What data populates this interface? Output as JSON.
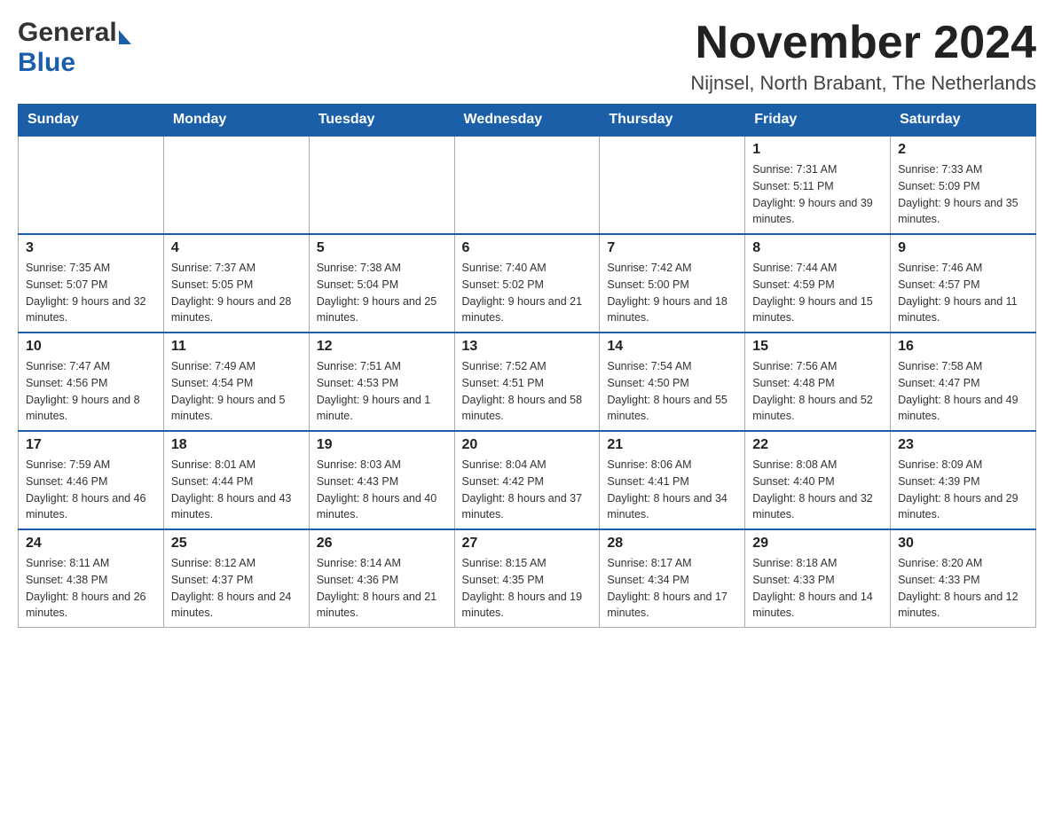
{
  "header": {
    "logo_general": "General",
    "logo_blue": "Blue",
    "month_title": "November 2024",
    "location": "Nijnsel, North Brabant, The Netherlands"
  },
  "weekdays": [
    "Sunday",
    "Monday",
    "Tuesday",
    "Wednesday",
    "Thursday",
    "Friday",
    "Saturday"
  ],
  "rows": [
    [
      {
        "day": "",
        "sunrise": "",
        "sunset": "",
        "daylight": ""
      },
      {
        "day": "",
        "sunrise": "",
        "sunset": "",
        "daylight": ""
      },
      {
        "day": "",
        "sunrise": "",
        "sunset": "",
        "daylight": ""
      },
      {
        "day": "",
        "sunrise": "",
        "sunset": "",
        "daylight": ""
      },
      {
        "day": "",
        "sunrise": "",
        "sunset": "",
        "daylight": ""
      },
      {
        "day": "1",
        "sunrise": "Sunrise: 7:31 AM",
        "sunset": "Sunset: 5:11 PM",
        "daylight": "Daylight: 9 hours and 39 minutes."
      },
      {
        "day": "2",
        "sunrise": "Sunrise: 7:33 AM",
        "sunset": "Sunset: 5:09 PM",
        "daylight": "Daylight: 9 hours and 35 minutes."
      }
    ],
    [
      {
        "day": "3",
        "sunrise": "Sunrise: 7:35 AM",
        "sunset": "Sunset: 5:07 PM",
        "daylight": "Daylight: 9 hours and 32 minutes."
      },
      {
        "day": "4",
        "sunrise": "Sunrise: 7:37 AM",
        "sunset": "Sunset: 5:05 PM",
        "daylight": "Daylight: 9 hours and 28 minutes."
      },
      {
        "day": "5",
        "sunrise": "Sunrise: 7:38 AM",
        "sunset": "Sunset: 5:04 PM",
        "daylight": "Daylight: 9 hours and 25 minutes."
      },
      {
        "day": "6",
        "sunrise": "Sunrise: 7:40 AM",
        "sunset": "Sunset: 5:02 PM",
        "daylight": "Daylight: 9 hours and 21 minutes."
      },
      {
        "day": "7",
        "sunrise": "Sunrise: 7:42 AM",
        "sunset": "Sunset: 5:00 PM",
        "daylight": "Daylight: 9 hours and 18 minutes."
      },
      {
        "day": "8",
        "sunrise": "Sunrise: 7:44 AM",
        "sunset": "Sunset: 4:59 PM",
        "daylight": "Daylight: 9 hours and 15 minutes."
      },
      {
        "day": "9",
        "sunrise": "Sunrise: 7:46 AM",
        "sunset": "Sunset: 4:57 PM",
        "daylight": "Daylight: 9 hours and 11 minutes."
      }
    ],
    [
      {
        "day": "10",
        "sunrise": "Sunrise: 7:47 AM",
        "sunset": "Sunset: 4:56 PM",
        "daylight": "Daylight: 9 hours and 8 minutes."
      },
      {
        "day": "11",
        "sunrise": "Sunrise: 7:49 AM",
        "sunset": "Sunset: 4:54 PM",
        "daylight": "Daylight: 9 hours and 5 minutes."
      },
      {
        "day": "12",
        "sunrise": "Sunrise: 7:51 AM",
        "sunset": "Sunset: 4:53 PM",
        "daylight": "Daylight: 9 hours and 1 minute."
      },
      {
        "day": "13",
        "sunrise": "Sunrise: 7:52 AM",
        "sunset": "Sunset: 4:51 PM",
        "daylight": "Daylight: 8 hours and 58 minutes."
      },
      {
        "day": "14",
        "sunrise": "Sunrise: 7:54 AM",
        "sunset": "Sunset: 4:50 PM",
        "daylight": "Daylight: 8 hours and 55 minutes."
      },
      {
        "day": "15",
        "sunrise": "Sunrise: 7:56 AM",
        "sunset": "Sunset: 4:48 PM",
        "daylight": "Daylight: 8 hours and 52 minutes."
      },
      {
        "day": "16",
        "sunrise": "Sunrise: 7:58 AM",
        "sunset": "Sunset: 4:47 PM",
        "daylight": "Daylight: 8 hours and 49 minutes."
      }
    ],
    [
      {
        "day": "17",
        "sunrise": "Sunrise: 7:59 AM",
        "sunset": "Sunset: 4:46 PM",
        "daylight": "Daylight: 8 hours and 46 minutes."
      },
      {
        "day": "18",
        "sunrise": "Sunrise: 8:01 AM",
        "sunset": "Sunset: 4:44 PM",
        "daylight": "Daylight: 8 hours and 43 minutes."
      },
      {
        "day": "19",
        "sunrise": "Sunrise: 8:03 AM",
        "sunset": "Sunset: 4:43 PM",
        "daylight": "Daylight: 8 hours and 40 minutes."
      },
      {
        "day": "20",
        "sunrise": "Sunrise: 8:04 AM",
        "sunset": "Sunset: 4:42 PM",
        "daylight": "Daylight: 8 hours and 37 minutes."
      },
      {
        "day": "21",
        "sunrise": "Sunrise: 8:06 AM",
        "sunset": "Sunset: 4:41 PM",
        "daylight": "Daylight: 8 hours and 34 minutes."
      },
      {
        "day": "22",
        "sunrise": "Sunrise: 8:08 AM",
        "sunset": "Sunset: 4:40 PM",
        "daylight": "Daylight: 8 hours and 32 minutes."
      },
      {
        "day": "23",
        "sunrise": "Sunrise: 8:09 AM",
        "sunset": "Sunset: 4:39 PM",
        "daylight": "Daylight: 8 hours and 29 minutes."
      }
    ],
    [
      {
        "day": "24",
        "sunrise": "Sunrise: 8:11 AM",
        "sunset": "Sunset: 4:38 PM",
        "daylight": "Daylight: 8 hours and 26 minutes."
      },
      {
        "day": "25",
        "sunrise": "Sunrise: 8:12 AM",
        "sunset": "Sunset: 4:37 PM",
        "daylight": "Daylight: 8 hours and 24 minutes."
      },
      {
        "day": "26",
        "sunrise": "Sunrise: 8:14 AM",
        "sunset": "Sunset: 4:36 PM",
        "daylight": "Daylight: 8 hours and 21 minutes."
      },
      {
        "day": "27",
        "sunrise": "Sunrise: 8:15 AM",
        "sunset": "Sunset: 4:35 PM",
        "daylight": "Daylight: 8 hours and 19 minutes."
      },
      {
        "day": "28",
        "sunrise": "Sunrise: 8:17 AM",
        "sunset": "Sunset: 4:34 PM",
        "daylight": "Daylight: 8 hours and 17 minutes."
      },
      {
        "day": "29",
        "sunrise": "Sunrise: 8:18 AM",
        "sunset": "Sunset: 4:33 PM",
        "daylight": "Daylight: 8 hours and 14 minutes."
      },
      {
        "day": "30",
        "sunrise": "Sunrise: 8:20 AM",
        "sunset": "Sunset: 4:33 PM",
        "daylight": "Daylight: 8 hours and 12 minutes."
      }
    ]
  ]
}
